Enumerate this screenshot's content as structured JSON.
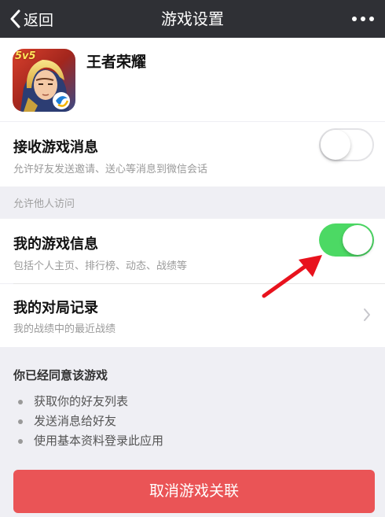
{
  "navbar": {
    "back_label": "返回",
    "title": "游戏设置"
  },
  "game": {
    "name": "王者荣耀",
    "icon_badge": "5v5"
  },
  "settings": {
    "receive_messages": {
      "title": "接收游戏消息",
      "desc": "允许好友发送邀请、送心等消息到微信会话",
      "enabled": false
    },
    "section_label": "允许他人访问",
    "game_info": {
      "title": "我的游戏信息",
      "desc": "包括个人主页、排行榜、动态、战绩等",
      "enabled": true
    },
    "match_records": {
      "title": "我的对局记录",
      "desc": "我的战绩中的最近战绩"
    }
  },
  "consent": {
    "title": "你已经同意该游戏",
    "items": [
      "获取你的好友列表",
      "发送消息给好友",
      "使用基本资料登录此应用"
    ]
  },
  "cancel_button": {
    "label": "取消游戏关联"
  },
  "colors": {
    "navbar": "#2f3035",
    "toggle_on": "#4cd964",
    "danger": "#ea5456",
    "background": "#efeff4"
  }
}
